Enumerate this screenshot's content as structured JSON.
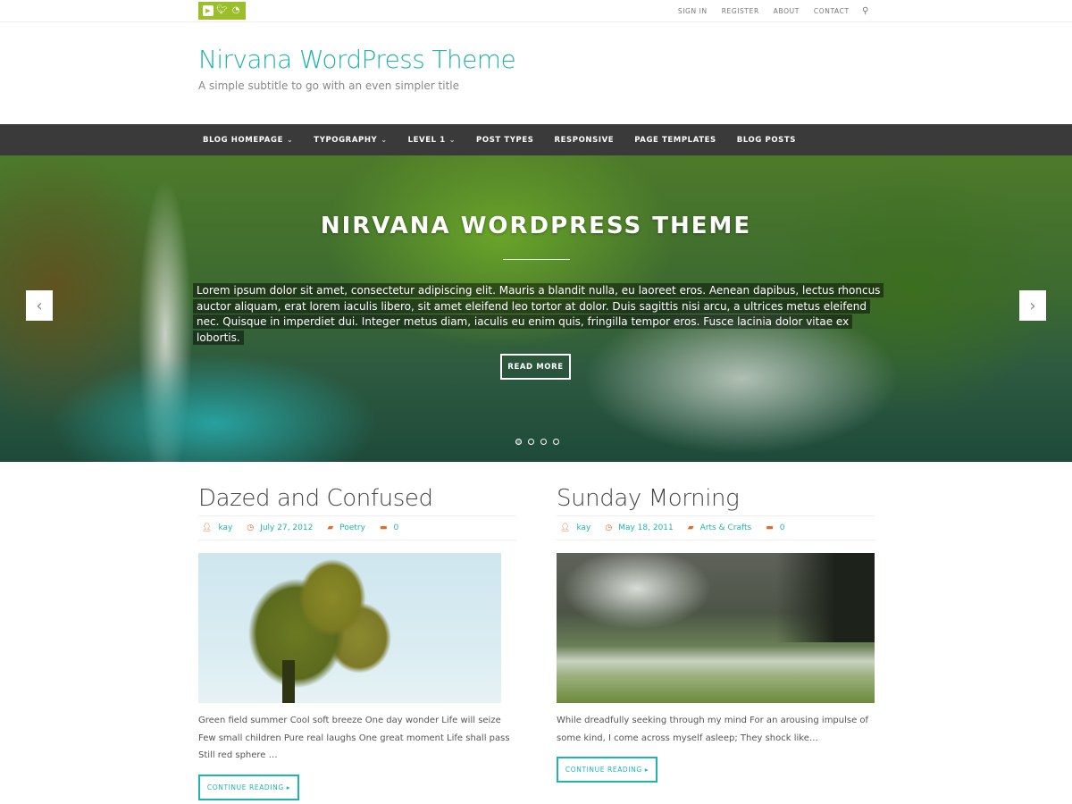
{
  "topbar": {
    "social": [
      "youtube-icon",
      "twitter-icon",
      "rss-icon"
    ],
    "links": [
      "SIGN IN",
      "REGISTER",
      "ABOUT",
      "CONTACT"
    ],
    "search_glyph": "⚲"
  },
  "header": {
    "title": "Nirvana WordPress Theme",
    "subtitle": "A simple subtitle to go with an even simpler title"
  },
  "nav": {
    "items": [
      {
        "label": "BLOG HOMEPAGE",
        "has_children": true
      },
      {
        "label": "TYPOGRAPHY",
        "has_children": true
      },
      {
        "label": "LEVEL 1",
        "has_children": true
      },
      {
        "label": "POST TYPES",
        "has_children": false
      },
      {
        "label": "RESPONSIVE",
        "has_children": false
      },
      {
        "label": "PAGE TEMPLATES",
        "has_children": false
      },
      {
        "label": "BLOG POSTS",
        "has_children": false
      }
    ],
    "chevron": "⌄"
  },
  "slider": {
    "title": "NIRVANA WORDPRESS THEME",
    "text": "Lorem ipsum dolor sit amet, consectetur adipiscing elit. Mauris a blandit nulla, eu laoreet eros. Aenean dapibus, lectus rhoncus auctor aliquam, erat lorem iaculis libero, sit amet eleifend leo tortor at dolor. Duis sagittis nisi arcu, a ultrices metus eleifend nec. Quisque in imperdiet dui. Integer metus diam, iaculis eu enim quis, fringilla tempor eros. Fusce lacinia dolor vitae ex lobortis.",
    "button": "READ MORE",
    "prev": "‹",
    "next": "›",
    "slide_count": 4,
    "active_slide": 1
  },
  "posts": [
    {
      "title": "Dazed and Confused",
      "author": "kay",
      "date": "July 27, 2012",
      "category": "Poetry",
      "comments": "0",
      "excerpt": "Green field summer Cool soft breeze One day wonder Life will seize Few small children Pure real laughs One great moment Life shall pass Still red sphere …",
      "button": "CONTINUE READING ▸"
    },
    {
      "title": "Sunday Morning",
      "author": "kay",
      "date": "May 18, 2011",
      "category": "Arts & Crafts",
      "comments": "0",
      "excerpt": "While dreadfully seeking through my mind For an arousing impulse of some kind, I come across myself asleep; They shock like…",
      "button": "CONTINUE READING ▸"
    }
  ],
  "colors": {
    "accent": "#1fb5ac",
    "social_bg": "#9bbf2a",
    "nav_bg": "#3a3a3a",
    "meta_icon": "#e06b2a"
  }
}
